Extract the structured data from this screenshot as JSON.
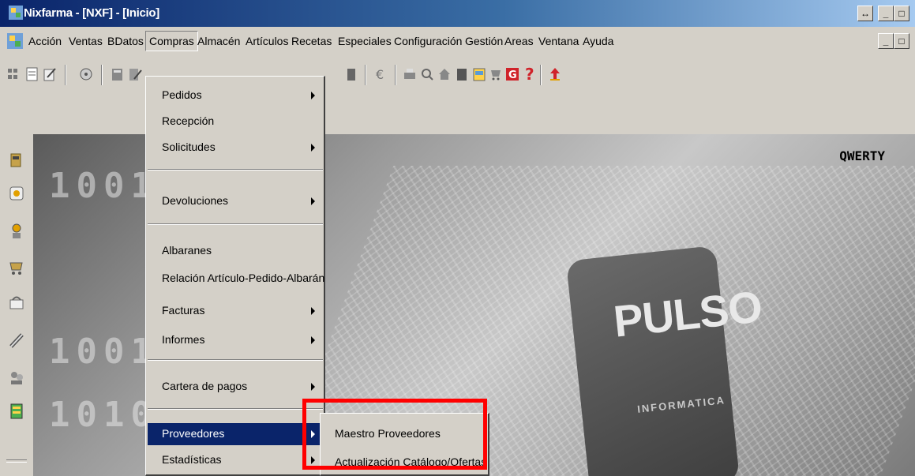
{
  "window": {
    "title": "Nixfarma - [NXF] - [Inicio]"
  },
  "menubar": {
    "items": [
      "Acción",
      "Ventas",
      "BDatos",
      "Compras",
      "Almacén",
      "Artículos",
      "Recetas",
      "Especiales",
      "Configuración",
      "Gestión",
      "Areas",
      "Ventana",
      "Ayuda"
    ],
    "active": "Compras"
  },
  "background": {
    "qwerty": "QWERTY",
    "brand": "PULSO",
    "brand_sub": "INFORMATICA",
    "digits_1": "1001",
    "digits_2": "1001",
    "digits_3": "1010"
  },
  "compras_menu": {
    "items": [
      {
        "label": "Pedidos",
        "submenu": true
      },
      {
        "label": "Recepción",
        "submenu": false
      },
      {
        "label": "Solicitudes",
        "submenu": true
      },
      {
        "label": "Devoluciones",
        "submenu": true
      },
      {
        "label": "Albaranes",
        "submenu": false
      },
      {
        "label": "Relación Artículo-Pedido-Albarán",
        "submenu": false
      },
      {
        "label": "Facturas",
        "submenu": true
      },
      {
        "label": "Informes",
        "submenu": true
      },
      {
        "label": "Cartera de pagos",
        "submenu": true
      },
      {
        "label": "Proveedores",
        "submenu": true,
        "highlighted": true
      },
      {
        "label": "Estadísticas",
        "submenu": true
      }
    ]
  },
  "proveedores_submenu": {
    "items": [
      "Maestro Proveedores",
      "Actualización Catálogo/Ofertas"
    ]
  },
  "colors": {
    "highlight": "#0a246a",
    "annotation": "#ff0000",
    "face": "#d4d0c8"
  },
  "icons": {
    "toolbar": [
      "grid-icon",
      "form-icon",
      "edit-icon",
      "disk-icon",
      "book-icon",
      "book-edit-icon",
      "tools-icon",
      "euro-icon",
      "print-icon",
      "search-icon",
      "home-icon",
      "block-icon",
      "schedule-icon",
      "cart-icon",
      "g-icon",
      "help-icon",
      "up-icon"
    ],
    "sidebar": [
      "cash-icon",
      "card-icon",
      "person-icon",
      "cart-icon",
      "basket-icon",
      "pen-icon",
      "people-icon",
      "register-icon"
    ]
  }
}
